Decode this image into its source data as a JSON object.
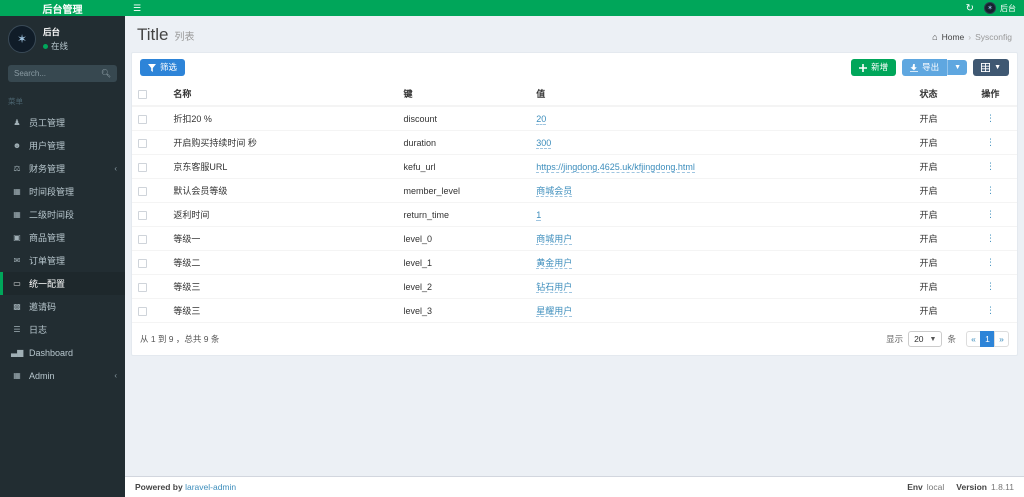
{
  "navbar": {
    "brand": "后台管理",
    "hamburger_icon": "menu-toggle-icon",
    "refresh_icon": "refresh-icon",
    "username": "后台"
  },
  "sidebar": {
    "user": {
      "name": "后台",
      "status": "在线"
    },
    "search_placeholder": "Search...",
    "menu_header": "菜单",
    "items": [
      {
        "label": "员工管理",
        "icon": "staff-icon",
        "glyph": "♟",
        "chevron": false,
        "active": false
      },
      {
        "label": "用户管理",
        "icon": "user-icon",
        "glyph": "☻",
        "chevron": false,
        "active": false
      },
      {
        "label": "财务管理",
        "icon": "finance-icon",
        "glyph": "⚖",
        "chevron": true,
        "active": false
      },
      {
        "label": "时间段管理",
        "icon": "schedule-icon",
        "glyph": "▦",
        "chevron": false,
        "active": false
      },
      {
        "label": "二级时间段",
        "icon": "sub-schedule-icon",
        "glyph": "▦",
        "chevron": false,
        "active": false
      },
      {
        "label": "商品管理",
        "icon": "goods-icon",
        "glyph": "▣",
        "chevron": false,
        "active": false
      },
      {
        "label": "订单管理",
        "icon": "orders-icon",
        "glyph": "✉",
        "chevron": false,
        "active": false
      },
      {
        "label": "统一配置",
        "icon": "config-icon",
        "glyph": "▭",
        "chevron": false,
        "active": true
      },
      {
        "label": "邀请码",
        "icon": "invite-code-icon",
        "glyph": "▩",
        "chevron": false,
        "active": false
      },
      {
        "label": "日志",
        "icon": "log-icon",
        "glyph": "☰",
        "chevron": false,
        "active": false
      },
      {
        "label": "Dashboard",
        "icon": "dashboard-icon",
        "glyph": "▃▆",
        "chevron": false,
        "active": false
      },
      {
        "label": "Admin",
        "icon": "admin-icon",
        "glyph": "▦",
        "chevron": true,
        "active": false
      }
    ]
  },
  "page": {
    "title": "Title",
    "subtitle": "列表",
    "breadcrumb": {
      "home_icon": "home-icon",
      "home": "Home",
      "separator": "›",
      "current": "Sysconfig"
    }
  },
  "toolbar": {
    "filter_label": "筛选",
    "create_label": "新增",
    "export_label": "导出"
  },
  "table": {
    "headers": {
      "name": "名称",
      "key": "键",
      "value": "值",
      "status": "状态",
      "action": "操作"
    },
    "rows": [
      {
        "name": "折扣20 %",
        "key": "discount",
        "value": "20",
        "status": "开启"
      },
      {
        "name": "开启购买持续时间 秒",
        "key": "duration",
        "value": "300",
        "status": "开启"
      },
      {
        "name": "京东客服URL",
        "key": "kefu_url",
        "value": "https://jingdong.4625.uk/kfjingdong.html",
        "status": "开启"
      },
      {
        "name": "默认会员等级",
        "key": "member_level",
        "value": "商城会员",
        "status": "开启"
      },
      {
        "name": "返利时间",
        "key": "return_time",
        "value": "1",
        "status": "开启"
      },
      {
        "name": "等级一",
        "key": "level_0",
        "value": "商城用户",
        "status": "开启"
      },
      {
        "name": "等级二",
        "key": "level_1",
        "value": "黄金用户",
        "status": "开启"
      },
      {
        "name": "等级三",
        "key": "level_2",
        "value": "钻石用户",
        "status": "开启"
      },
      {
        "name": "等级三",
        "key": "level_3",
        "value": "星耀用户",
        "status": "开启"
      }
    ],
    "action_icon": "more-vertical-icon",
    "action_glyph": "⋮"
  },
  "pagination": {
    "summary": "从 1 到 9 ，总共 9 条",
    "show_label": "显示",
    "per_page": "20",
    "unit_label": "条",
    "prev": "«",
    "page": "1",
    "next": "»"
  },
  "footer": {
    "powered_by": "Powered by",
    "brand": "laravel-admin",
    "env_label": "Env",
    "env_value": "local",
    "version_label": "Version",
    "version_value": "1.8.11"
  },
  "colors": {
    "accent_green": "#00a65a",
    "sidebar_bg": "#222d32",
    "content_bg": "#ecf0f5",
    "primary_blue": "#2d84d8",
    "link_blue": "#3c8dbc",
    "export_blue": "#5fa7e0",
    "grid_btn_navy": "#3f5872"
  }
}
